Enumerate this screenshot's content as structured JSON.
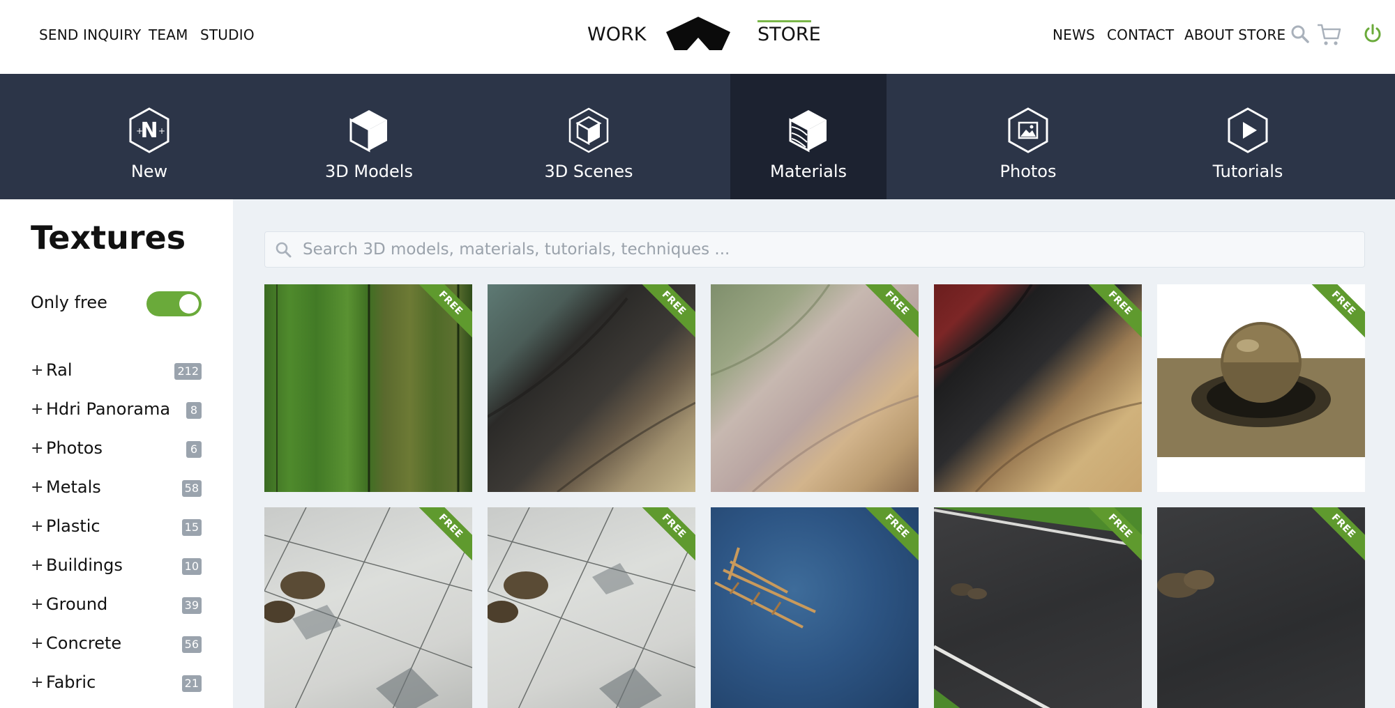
{
  "topnav": {
    "left_links": [
      "SEND INQUIRY",
      "TEAM",
      "STUDIO"
    ],
    "work": "WORK",
    "store": "STORE",
    "right_links": [
      "NEWS",
      "CONTACT",
      "ABOUT STORE"
    ],
    "icons": [
      "search-icon",
      "cart-icon",
      "power-icon"
    ],
    "accent": "#7ab648"
  },
  "categories": [
    {
      "label": "New",
      "icon": "new-badge-icon"
    },
    {
      "label": "3D Models",
      "icon": "cube-icon"
    },
    {
      "label": "3D Scenes",
      "icon": "scene-cube-icon"
    },
    {
      "label": "Materials",
      "icon": "material-cube-icon",
      "active": true
    },
    {
      "label": "Photos",
      "icon": "photo-icon"
    },
    {
      "label": "Tutorials",
      "icon": "play-icon"
    }
  ],
  "sidebar": {
    "title": "Textures",
    "only_free_label": "Only free",
    "only_free": true,
    "items": [
      {
        "label": "Ral",
        "count": "212"
      },
      {
        "label": "Hdri Panorama",
        "count": "8"
      },
      {
        "label": "Photos",
        "count": "6"
      },
      {
        "label": "Metals",
        "count": "58"
      },
      {
        "label": "Plastic",
        "count": "15"
      },
      {
        "label": "Buildings",
        "count": "10"
      },
      {
        "label": "Ground",
        "count": "39"
      },
      {
        "label": "Concrete",
        "count": "56"
      },
      {
        "label": "Fabric",
        "count": "21"
      }
    ]
  },
  "search": {
    "placeholder": "Search 3D models, materials, tutorials, techniques ..."
  },
  "tiles": [
    {
      "kind": "grass",
      "badge": "FREE"
    },
    {
      "kind": "fabric-dark",
      "badge": "FREE"
    },
    {
      "kind": "fabric-pastel",
      "badge": "FREE"
    },
    {
      "kind": "leather",
      "badge": "FREE"
    },
    {
      "kind": "metal-sphere",
      "badge": "FREE"
    },
    {
      "kind": "floor-tiles",
      "badge": "FREE"
    },
    {
      "kind": "floor-tiles",
      "badge": "FREE"
    },
    {
      "kind": "water",
      "badge": "FREE"
    },
    {
      "kind": "road",
      "badge": "FREE"
    },
    {
      "kind": "asphalt",
      "badge": "FREE"
    }
  ]
}
